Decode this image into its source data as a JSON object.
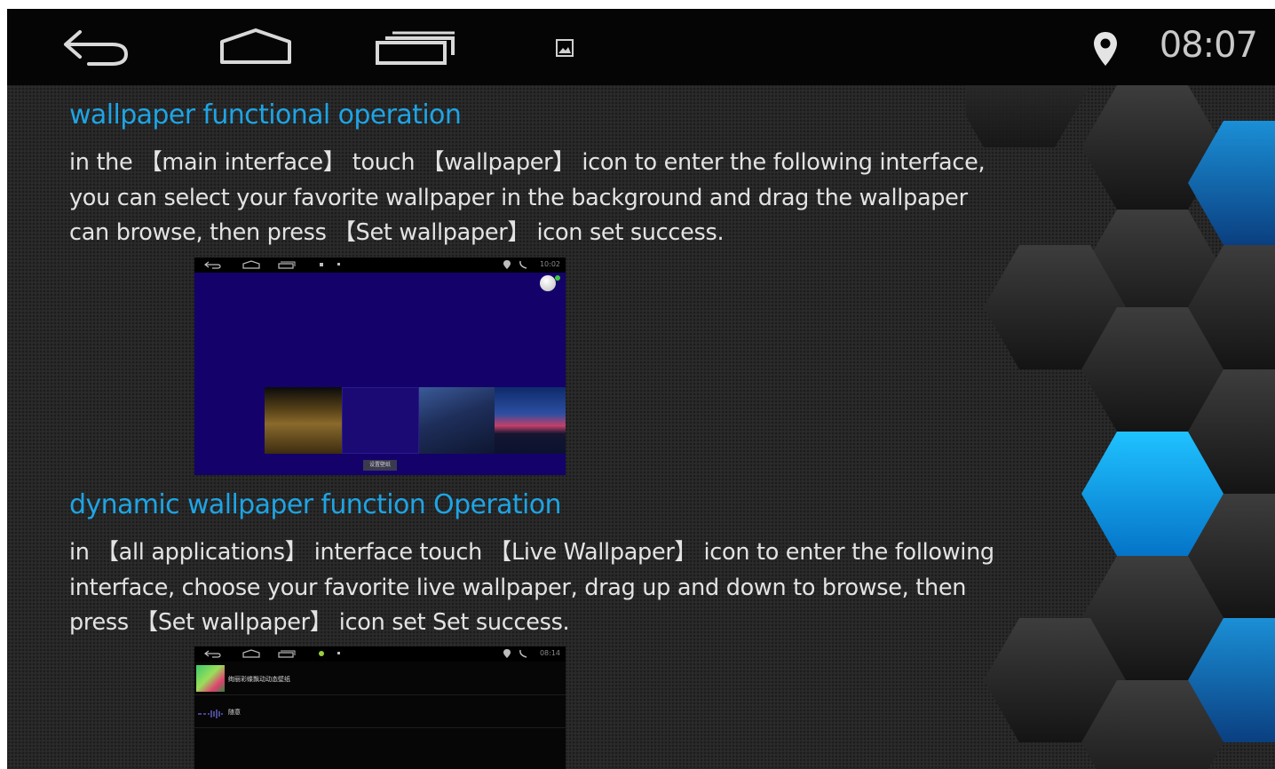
{
  "status_bar": {
    "clock": "08:07",
    "icons": [
      "back-icon",
      "home-icon",
      "recent-apps-icon",
      "gallery-notification-icon",
      "location-icon"
    ]
  },
  "sections": [
    {
      "heading": "wallpaper functional operation",
      "paragraph": "in the 【main interface】 touch 【wallpaper】 icon to enter the following interface, you can select your favorite wallpaper in the background and drag the wallpaper can browse, then press 【Set wallpaper】 icon set success.",
      "screenshot": {
        "time": "10:02",
        "button_label": "设置壁纸"
      }
    },
    {
      "heading": "dynamic wallpaper function Operation",
      "paragraph": "in 【all applications】 interface touch 【Live Wallpaper】 icon to enter the following interface, choose your favorite live wallpaper, drag up and down to browse, then press 【Set wallpaper】 icon set Set success.",
      "screenshot": {
        "time": "08:14",
        "list_items": [
          "绚丽彩蝶飘动动态壁纸",
          "随意"
        ]
      }
    }
  ],
  "colors": {
    "heading": "#1ea4e4",
    "text": "#e3e3e3",
    "status_bar": "#050505",
    "hex_blue": "#0aa8ea"
  }
}
